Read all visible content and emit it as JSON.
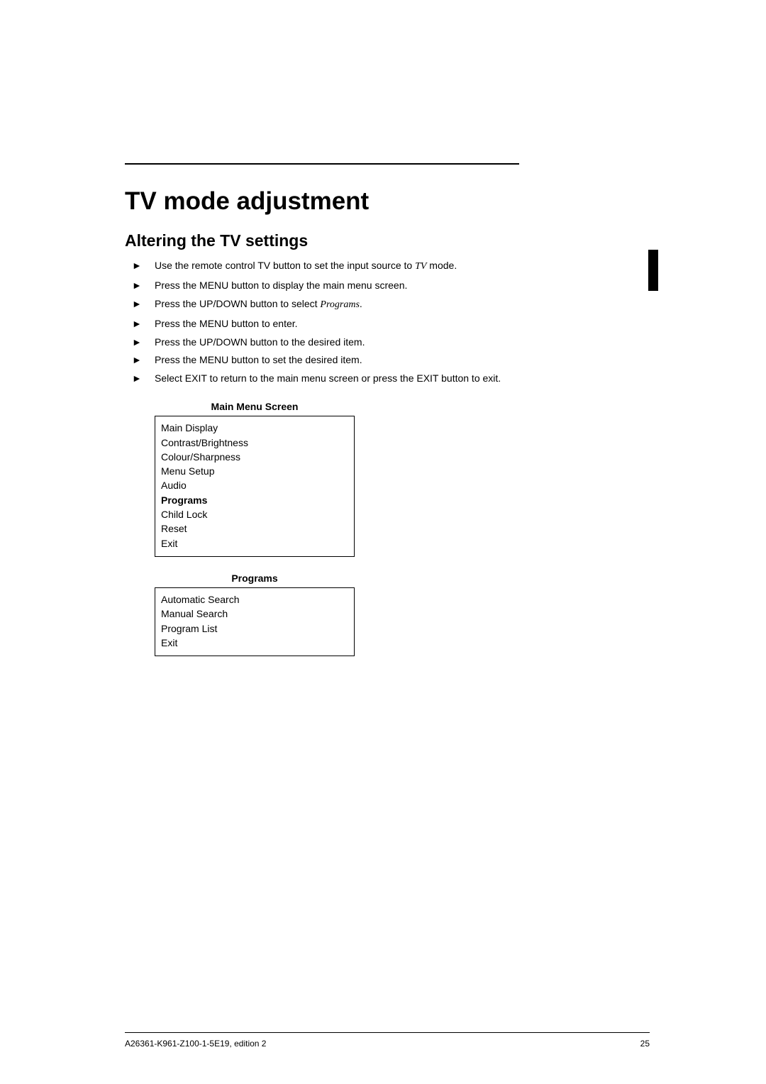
{
  "title": "TV mode adjustment",
  "subtitle": "Altering the TV settings",
  "instructions": [
    {
      "pre": "Use the remote control TV button to set the input source to ",
      "italic": "TV",
      "post": " mode."
    },
    {
      "pre": "Press the MENU button to display the main menu screen.",
      "italic": "",
      "post": ""
    },
    {
      "pre": "Press the UP/DOWN button to select ",
      "italic": "Programs",
      "post": "."
    },
    {
      "pre": "Press the MENU button to enter.",
      "italic": "",
      "post": ""
    },
    {
      "pre": "Press the UP/DOWN button to the desired item.",
      "italic": "",
      "post": ""
    },
    {
      "pre": "Press the MENU button to set the desired item.",
      "italic": "",
      "post": ""
    },
    {
      "pre": "Select EXIT to return to the main menu screen or press the EXIT button to exit.",
      "italic": "",
      "post": ""
    }
  ],
  "arrow_glyph": "►",
  "menus": [
    {
      "caption": "Main Menu Screen",
      "items": [
        {
          "label": "Main Display",
          "bold": false
        },
        {
          "label": "Contrast/Brightness",
          "bold": false
        },
        {
          "label": "Colour/Sharpness",
          "bold": false
        },
        {
          "label": "Menu Setup",
          "bold": false
        },
        {
          "label": "Audio",
          "bold": false
        },
        {
          "label": "Programs",
          "bold": true
        },
        {
          "label": "Child Lock",
          "bold": false
        },
        {
          "label": "Reset",
          "bold": false
        },
        {
          "label": "Exit",
          "bold": false
        }
      ]
    },
    {
      "caption": "Programs",
      "items": [
        {
          "label": "Automatic Search",
          "bold": false
        },
        {
          "label": "Manual Search",
          "bold": false
        },
        {
          "label": "Program List",
          "bold": false
        },
        {
          "label": "Exit",
          "bold": false
        }
      ]
    }
  ],
  "footer": {
    "left": "A26361-K961-Z100-1-5E19, edition 2",
    "right": "25"
  }
}
